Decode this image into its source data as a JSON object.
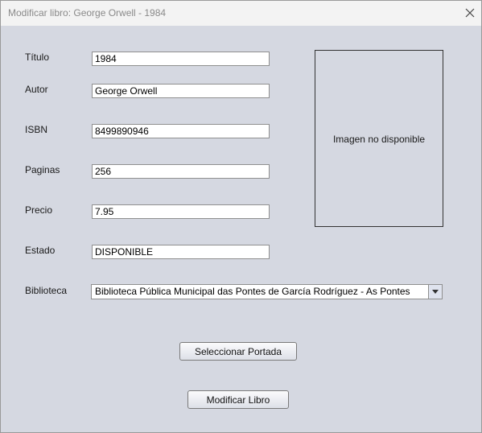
{
  "window": {
    "title": "Modificar libro: George Orwell - 1984",
    "close_icon": "close-icon"
  },
  "form": {
    "titulo": {
      "label": "Título",
      "value": "1984"
    },
    "autor": {
      "label": "Autor",
      "value": "George Orwell"
    },
    "isbn": {
      "label": "ISBN",
      "value": "8499890946"
    },
    "paginas": {
      "label": "Paginas",
      "value": "256"
    },
    "precio": {
      "label": "Precio",
      "value": "7.95"
    },
    "estado": {
      "label": "Estado",
      "value": "DISPONIBLE"
    },
    "biblioteca": {
      "label": "Biblioteca",
      "selected": "Biblioteca Pública Municipal das Pontes de García Rodríguez - As Pontes"
    }
  },
  "cover": {
    "placeholder": "Imagen no disponible"
  },
  "buttons": {
    "select_cover": "Seleccionar Portada",
    "modify_book": "Modificar Libro"
  }
}
